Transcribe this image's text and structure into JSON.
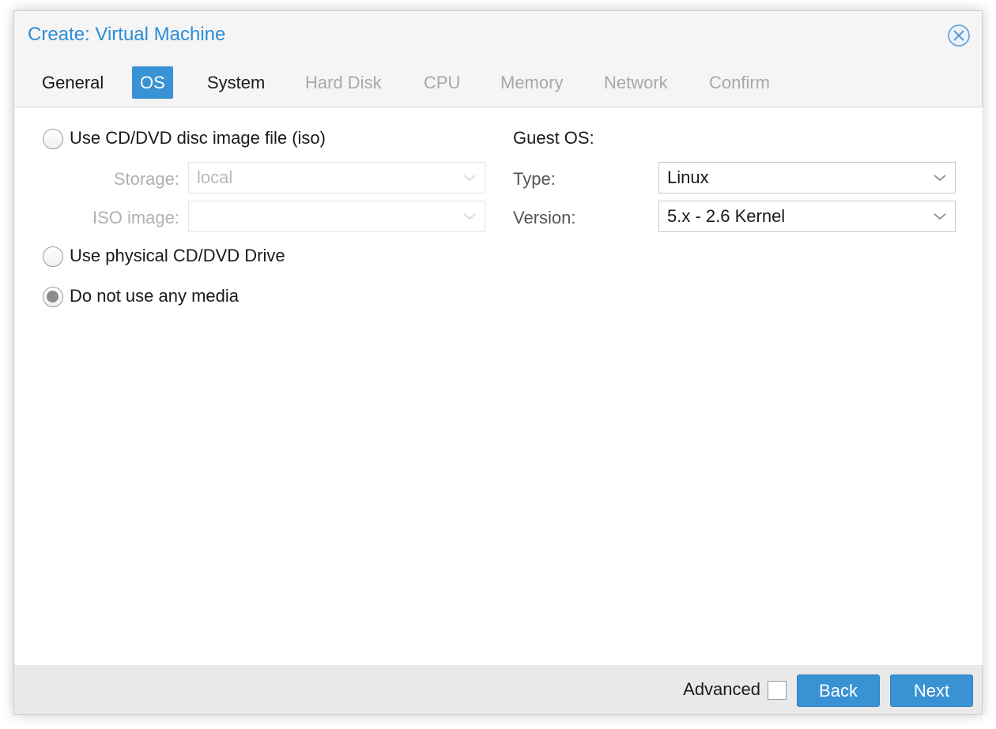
{
  "dialog": {
    "title": "Create: Virtual Machine",
    "close_icon": "close-circle-icon"
  },
  "tabs": [
    {
      "label": "General",
      "state": "enabled"
    },
    {
      "label": "OS",
      "state": "active"
    },
    {
      "label": "System",
      "state": "enabled"
    },
    {
      "label": "Hard Disk",
      "state": "disabled"
    },
    {
      "label": "CPU",
      "state": "disabled"
    },
    {
      "label": "Memory",
      "state": "disabled"
    },
    {
      "label": "Network",
      "state": "disabled"
    },
    {
      "label": "Confirm",
      "state": "disabled"
    }
  ],
  "media": {
    "options": [
      {
        "label": "Use CD/DVD disc image file (iso)",
        "checked": false
      },
      {
        "label": "Use physical CD/DVD Drive",
        "checked": false
      },
      {
        "label": "Do not use any media",
        "checked": true
      }
    ],
    "storage_label": "Storage:",
    "storage_value": "local",
    "iso_label": "ISO image:",
    "iso_value": ""
  },
  "guest_os": {
    "heading": "Guest OS:",
    "type_label": "Type:",
    "type_value": "Linux",
    "version_label": "Version:",
    "version_value": "5.x - 2.6 Kernel"
  },
  "footer": {
    "advanced_label": "Advanced",
    "advanced_checked": false,
    "back_label": "Back",
    "next_label": "Next"
  },
  "colors": {
    "accent": "#3892d4",
    "title": "#2c8dd6",
    "disabled_text": "#a8a8a8"
  }
}
